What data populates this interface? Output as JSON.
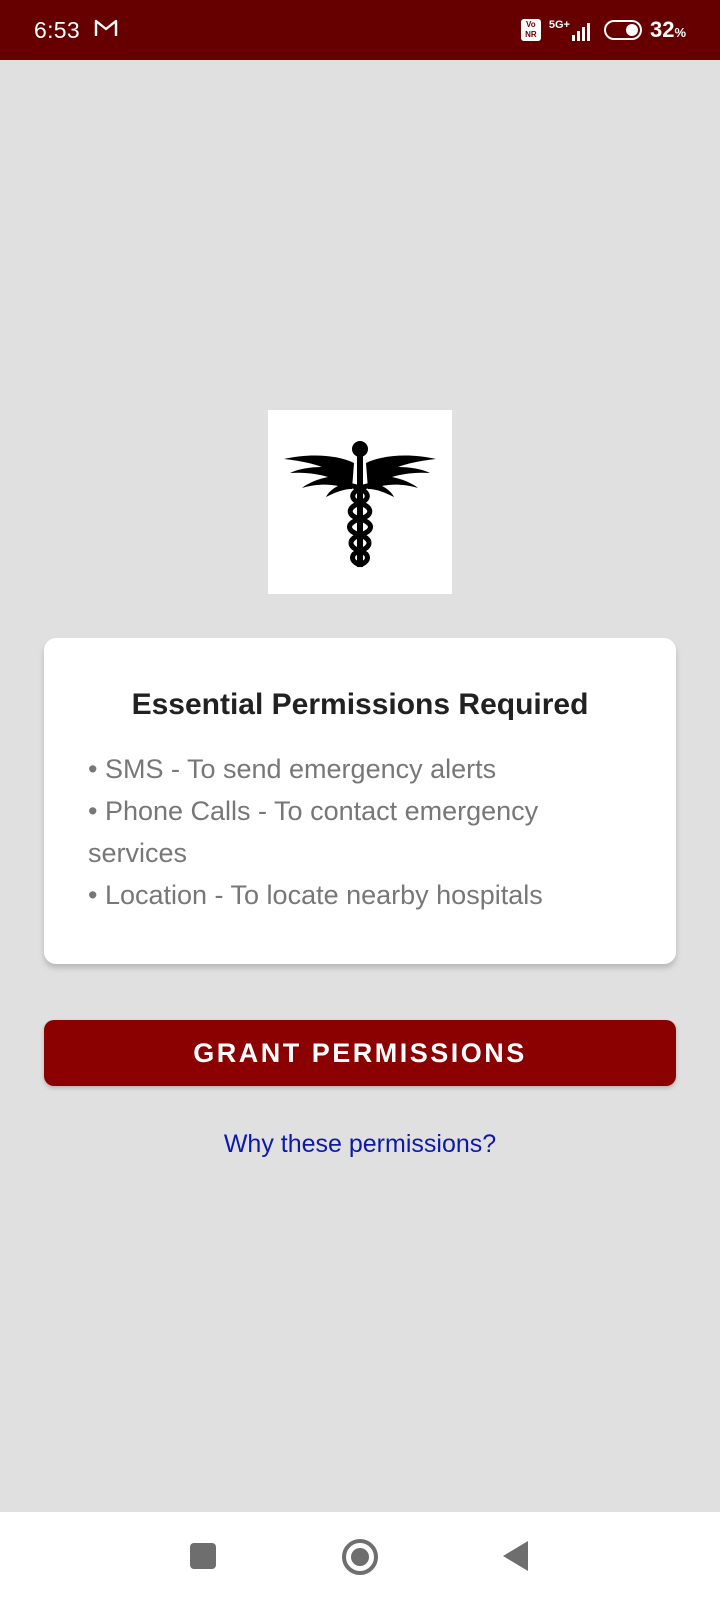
{
  "status_bar": {
    "time": "6:53",
    "notification_icon": "gmail-icon",
    "volte_line1": "Vo",
    "volte_line2": "NR",
    "network": "5G+",
    "battery_value": "32",
    "battery_unit": "%"
  },
  "logo": {
    "icon": "caduceus-icon"
  },
  "card": {
    "title": "Essential Permissions Required",
    "permissions": [
      "• SMS - To send emergency alerts",
      "• Phone Calls - To contact emergency services",
      "• Location - To locate nearby hospitals"
    ]
  },
  "grant_button": {
    "label": "GRANT PERMISSIONS"
  },
  "why_link": {
    "label": "Why these permissions?"
  },
  "nav_bar": {
    "recents_icon": "square-icon",
    "home_icon": "circle-icon",
    "back_icon": "triangle-back-icon"
  },
  "colors": {
    "status_bar": "#660000",
    "background": "#e0e0e0",
    "button": "#8b0000",
    "link": "#0d1aa8"
  }
}
